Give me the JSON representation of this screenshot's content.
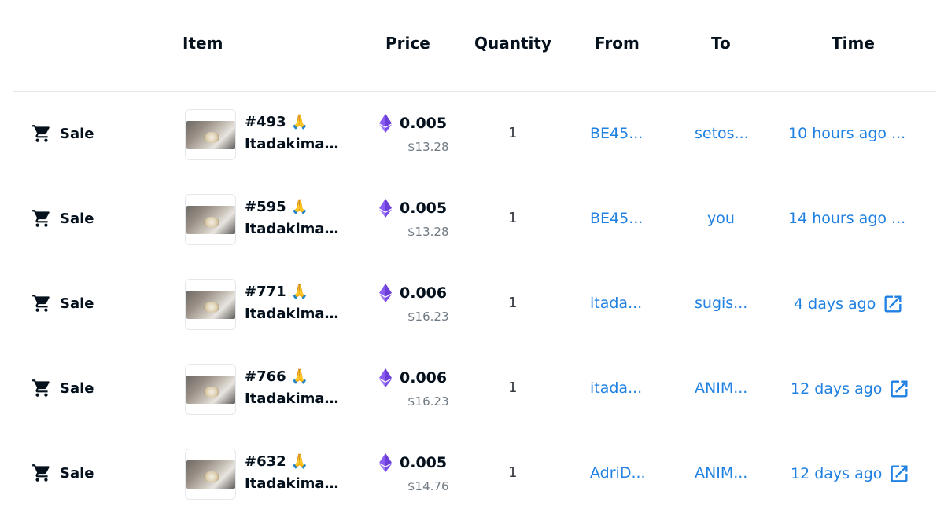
{
  "header": {
    "item": "Item",
    "price": "Price",
    "quantity": "Quantity",
    "from": "From",
    "to": "To",
    "time": "Time"
  },
  "colors": {
    "link": "#2081e2",
    "text": "#04111d",
    "muted": "#707a83",
    "eth": "#8a5cf6"
  },
  "rows": [
    {
      "event": "Sale",
      "event_icon": "cart-icon",
      "number": "#493",
      "emoji": "🙏",
      "name": "Itadakimas...",
      "price_eth": "0.005",
      "price_usd": "$13.28",
      "quantity": "1",
      "from": "BE45...",
      "to": "setos...",
      "time": "10 hours ago ...",
      "time_link_icon": false
    },
    {
      "event": "Sale",
      "event_icon": "cart-icon",
      "number": "#595",
      "emoji": "🙏",
      "name": "Itadakimas...",
      "price_eth": "0.005",
      "price_usd": "$13.28",
      "quantity": "1",
      "from": "BE45...",
      "to": "you",
      "time": "14 hours ago ...",
      "time_link_icon": false
    },
    {
      "event": "Sale",
      "event_icon": "cart-icon",
      "number": "#771",
      "emoji": "🙏",
      "name": "Itadakimas...",
      "price_eth": "0.006",
      "price_usd": "$16.23",
      "quantity": "1",
      "from": "itada...",
      "to": "sugis...",
      "time": "4 days ago",
      "time_link_icon": true
    },
    {
      "event": "Sale",
      "event_icon": "cart-icon",
      "number": "#766",
      "emoji": "🙏",
      "name": "Itadakimas...",
      "price_eth": "0.006",
      "price_usd": "$16.23",
      "quantity": "1",
      "from": "itada...",
      "to": "ANIM...",
      "time": "12 days ago",
      "time_link_icon": true
    },
    {
      "event": "Sale",
      "event_icon": "cart-icon",
      "number": "#632",
      "emoji": "🙏",
      "name": "Itadakimas...",
      "price_eth": "0.005",
      "price_usd": "$14.76",
      "quantity": "1",
      "from": "AdriD...",
      "to": "ANIM...",
      "time": "12 days ago",
      "time_link_icon": true
    }
  ]
}
